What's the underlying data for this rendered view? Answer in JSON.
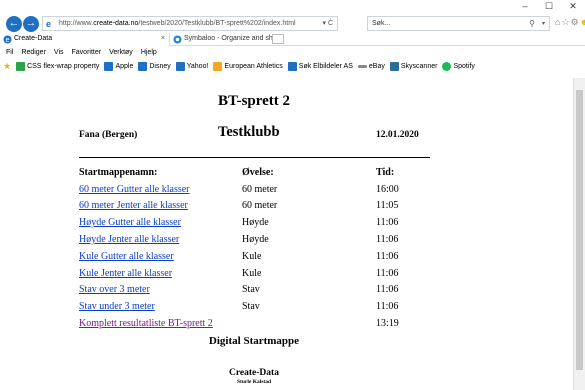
{
  "window": {
    "minimize": "–",
    "maximize": "☐",
    "close": "✕"
  },
  "address": {
    "prefix": "http://www.",
    "domain": "create-data.no",
    "path": "/testweb/2020/Testklubb/BT-sprett%202/index.html",
    "controls": "▾ Ċ"
  },
  "search": {
    "placeholder": "Søk...",
    "icon": "search-icon"
  },
  "tabs": [
    {
      "label": "Create-Data",
      "close": "×",
      "active": true
    },
    {
      "label": "Symbaloo - Organize and shar...",
      "active": false
    }
  ],
  "menu": [
    "Fil",
    "Rediger",
    "Vis",
    "Favoritter",
    "Verktøy",
    "Hjelp"
  ],
  "favorites": [
    {
      "label": "CSS flex-wrap property",
      "color": "#2aa44a"
    },
    {
      "label": "Apple",
      "color": "#1f6fc5"
    },
    {
      "label": "Disney",
      "color": "#1f6fc5"
    },
    {
      "label": "Yahoo!",
      "color": "#1f6fc5"
    },
    {
      "label": "European Athletics",
      "color": "#f5a623"
    },
    {
      "label": "Søk Elbildeler AS",
      "color": "#1f6fc5"
    },
    {
      "label": "eBay",
      "color": "#888888"
    },
    {
      "label": "Skyscanner",
      "color": "#2c6e9b"
    },
    {
      "label": "Spotify",
      "color": "#1db954"
    }
  ],
  "page": {
    "title": "BT-sprett 2",
    "place": "Fana (Bergen)",
    "club": "Testklubb",
    "date": "12.01.2020",
    "headers": {
      "name": "Startmappenamn:",
      "event": "Øvelse:",
      "time": "Tid:"
    },
    "rows": [
      {
        "name": "60 meter Gutter alle klasser",
        "event": "60 meter",
        "time": "16:00"
      },
      {
        "name": "60 meter Jenter alle klasser",
        "event": "60 meter",
        "time": "11:05"
      },
      {
        "name": "Høyde Gutter alle klasser",
        "event": "Høyde",
        "time": "11:06"
      },
      {
        "name": "Høyde Jenter alle klasser",
        "event": "Høyde",
        "time": "11:06"
      },
      {
        "name": "Kule Gutter alle klasser",
        "event": "Kule",
        "time": "11:06"
      },
      {
        "name": "Kule Jenter alle klasser",
        "event": "Kule",
        "time": "11:06"
      },
      {
        "name": "Stav over 3 meter",
        "event": "Stav",
        "time": "11:06"
      },
      {
        "name": "Stav under 3 meter",
        "event": "Stav",
        "time": "11:06"
      },
      {
        "name": "Komplett resultatliste BT-sprett 2",
        "event": "",
        "time": "13:19",
        "visited": true
      }
    ],
    "footer_title": "Digital Startmappe",
    "footer_org": "Create-Data",
    "footer_author": "Sturle Kalstad"
  }
}
